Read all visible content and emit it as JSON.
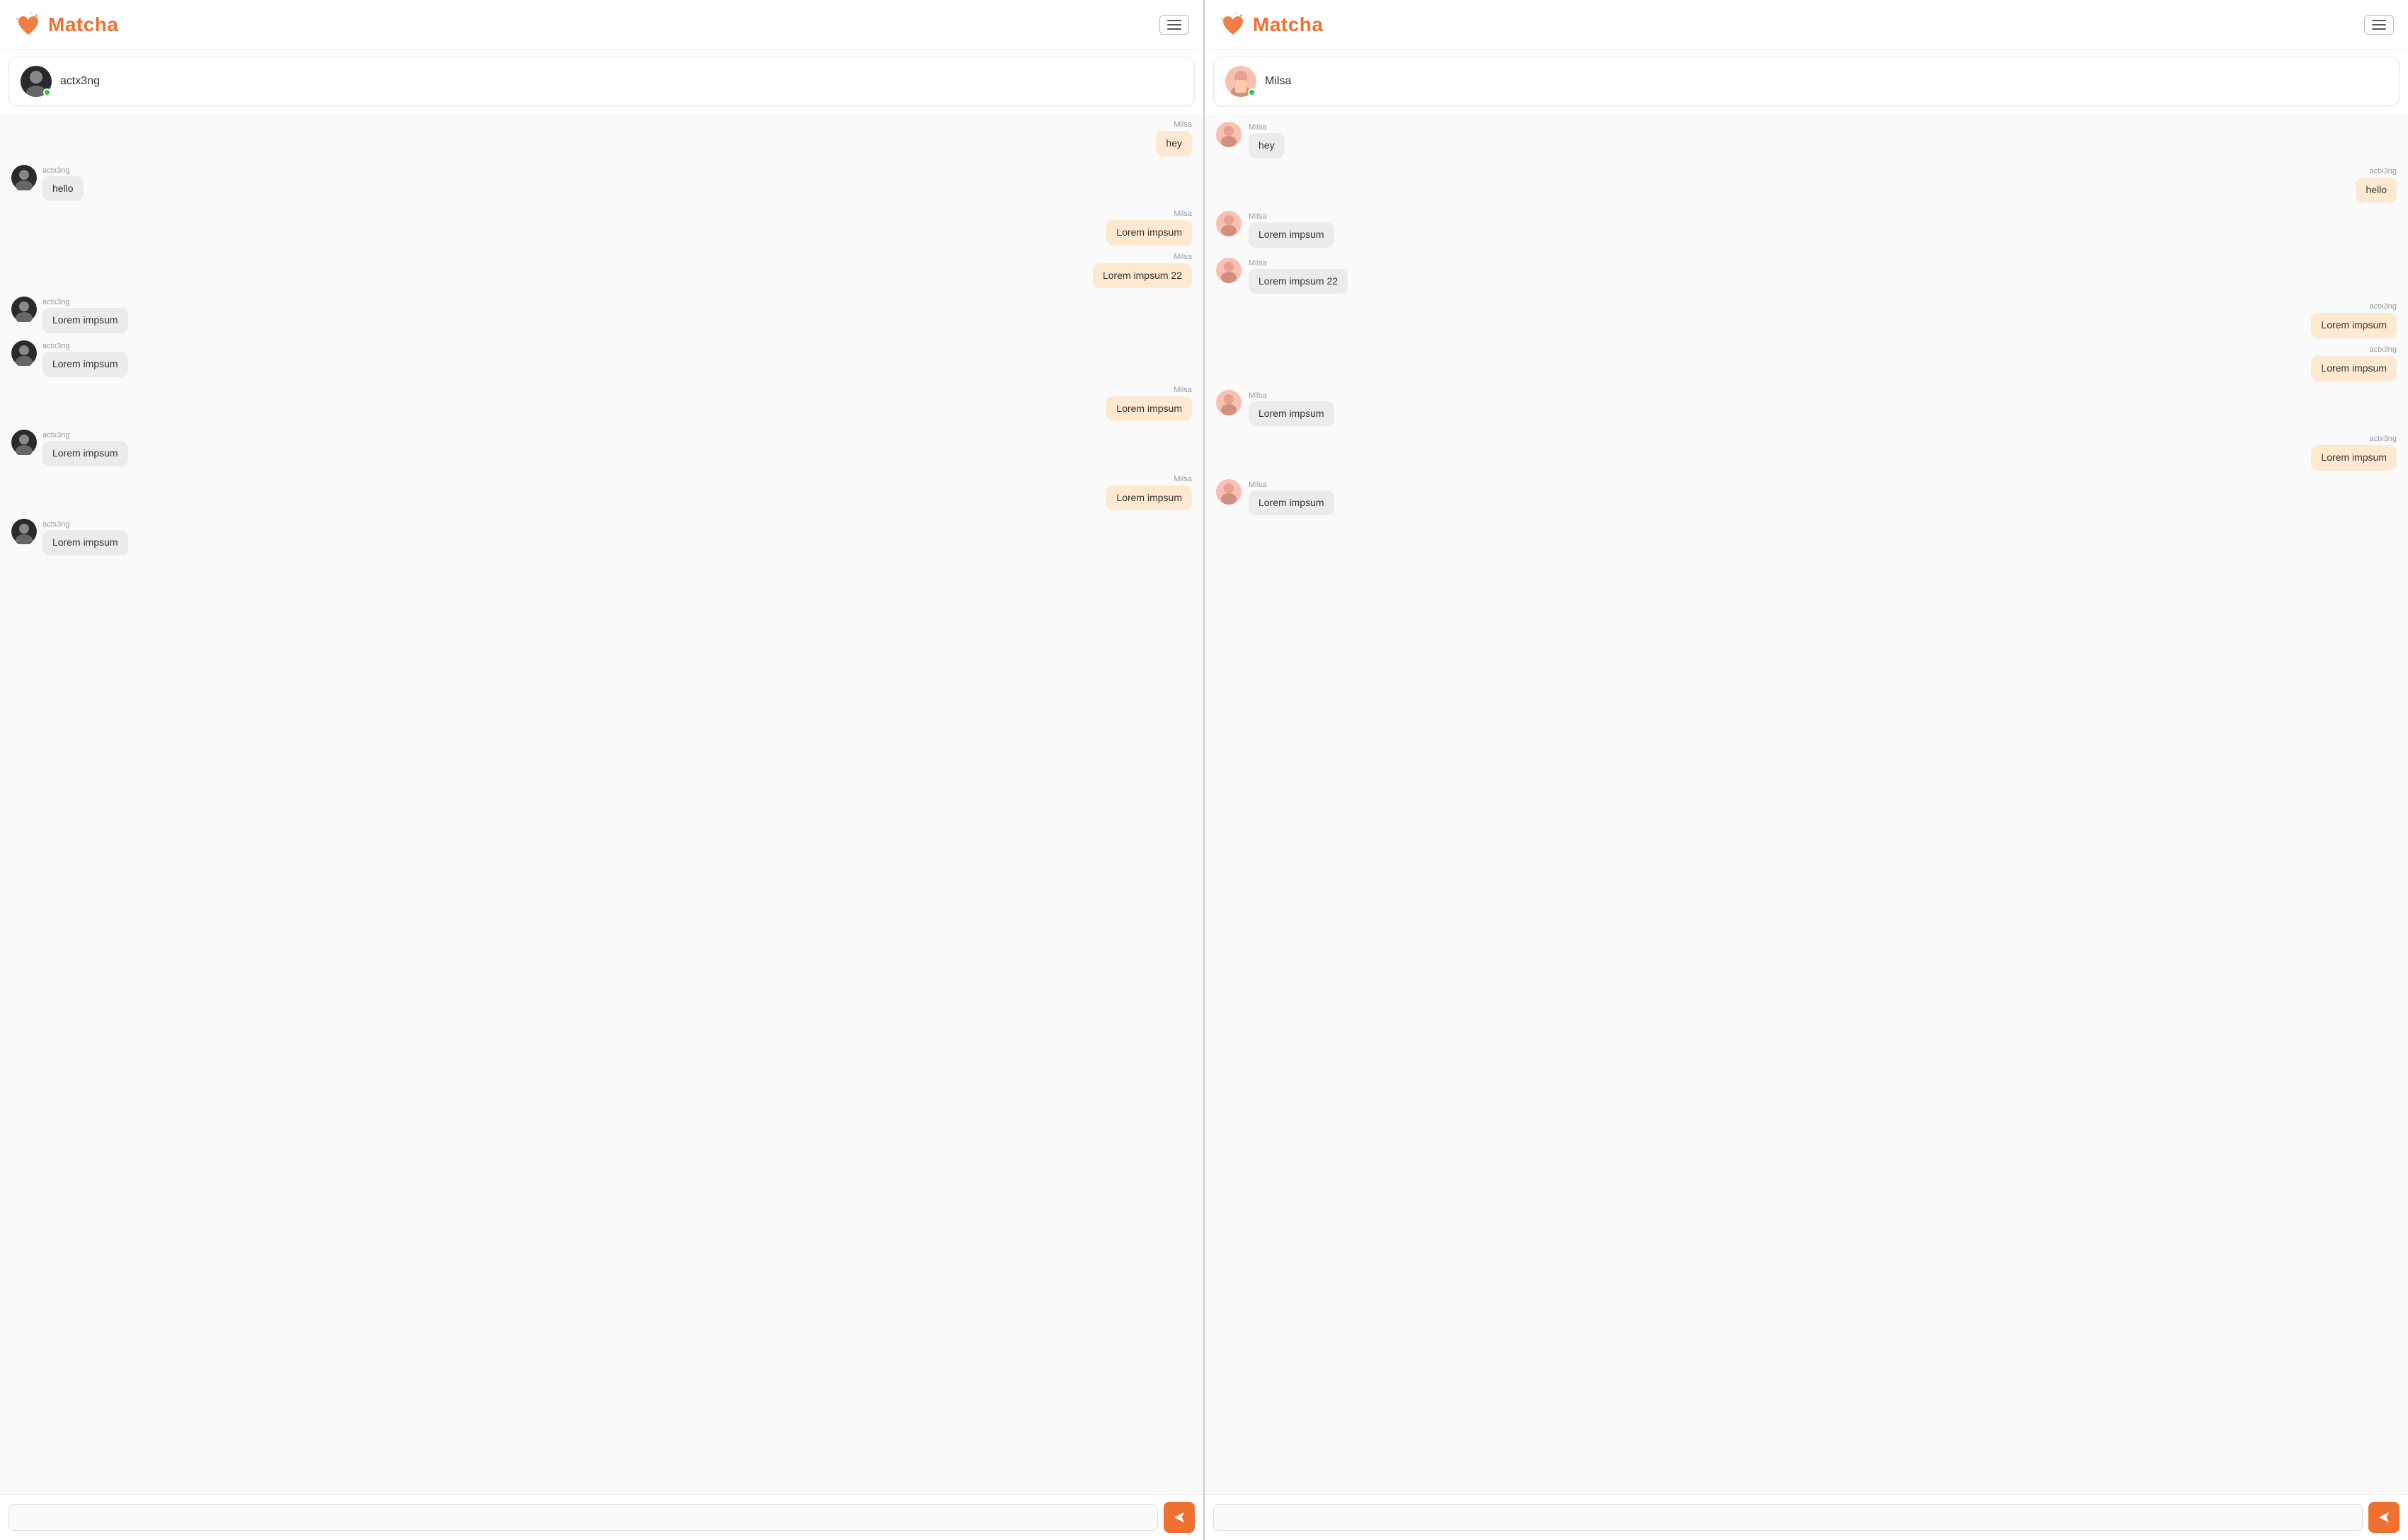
{
  "app": {
    "name": "Matcha"
  },
  "left_panel": {
    "header": {
      "logo": "Matcha",
      "menu_label": "menu"
    },
    "contact": {
      "name": "actx3ng",
      "online": true,
      "avatar_type": "dark"
    },
    "messages": [
      {
        "id": 1,
        "sender": "Milsa",
        "side": "right",
        "text": "hey"
      },
      {
        "id": 2,
        "sender": "actx3ng",
        "side": "left",
        "text": "hello"
      },
      {
        "id": 3,
        "sender": "Milsa",
        "side": "right",
        "text": "Lorem impsum"
      },
      {
        "id": 4,
        "sender": "Milsa",
        "side": "right",
        "text": "Lorem impsum 22"
      },
      {
        "id": 5,
        "sender": "actx3ng",
        "side": "left",
        "text": "Lorem impsum"
      },
      {
        "id": 6,
        "sender": "actx3ng",
        "side": "left",
        "text": "Lorem impsum"
      },
      {
        "id": 7,
        "sender": "Milsa",
        "side": "right",
        "text": "Lorem impsum"
      },
      {
        "id": 8,
        "sender": "actx3ng",
        "side": "left",
        "text": "Lorem impsum"
      },
      {
        "id": 9,
        "sender": "Milsa",
        "side": "right",
        "text": "Lorem impsum"
      },
      {
        "id": 10,
        "sender": "actx3ng",
        "side": "left",
        "text": "Lorem impsum"
      }
    ],
    "input": {
      "placeholder": ""
    },
    "send_button": ">"
  },
  "right_panel": {
    "header": {
      "logo": "Matcha",
      "menu_label": "menu"
    },
    "contact": {
      "name": "Milsa",
      "online": true,
      "avatar_type": "pink"
    },
    "messages": [
      {
        "id": 1,
        "sender": "Milsa",
        "side": "left",
        "text": "hey"
      },
      {
        "id": 2,
        "sender": "actx3ng",
        "side": "right",
        "text": "hello"
      },
      {
        "id": 3,
        "sender": "Milsa",
        "side": "left",
        "text": "Lorem impsum"
      },
      {
        "id": 4,
        "sender": "Milsa",
        "side": "left",
        "text": "Lorem impsum 22"
      },
      {
        "id": 5,
        "sender": "actx3ng",
        "side": "right",
        "text": "Lorem impsum"
      },
      {
        "id": 6,
        "sender": "actx3ng",
        "side": "right",
        "text": "Lorem impsum"
      },
      {
        "id": 7,
        "sender": "Milsa",
        "side": "left",
        "text": "Lorem impsum"
      },
      {
        "id": 8,
        "sender": "actx3ng",
        "side": "right",
        "text": "Lorem impsum"
      },
      {
        "id": 9,
        "sender": "Milsa",
        "side": "left",
        "text": "Lorem impsum"
      }
    ],
    "input": {
      "placeholder": ""
    },
    "send_button": ">"
  }
}
